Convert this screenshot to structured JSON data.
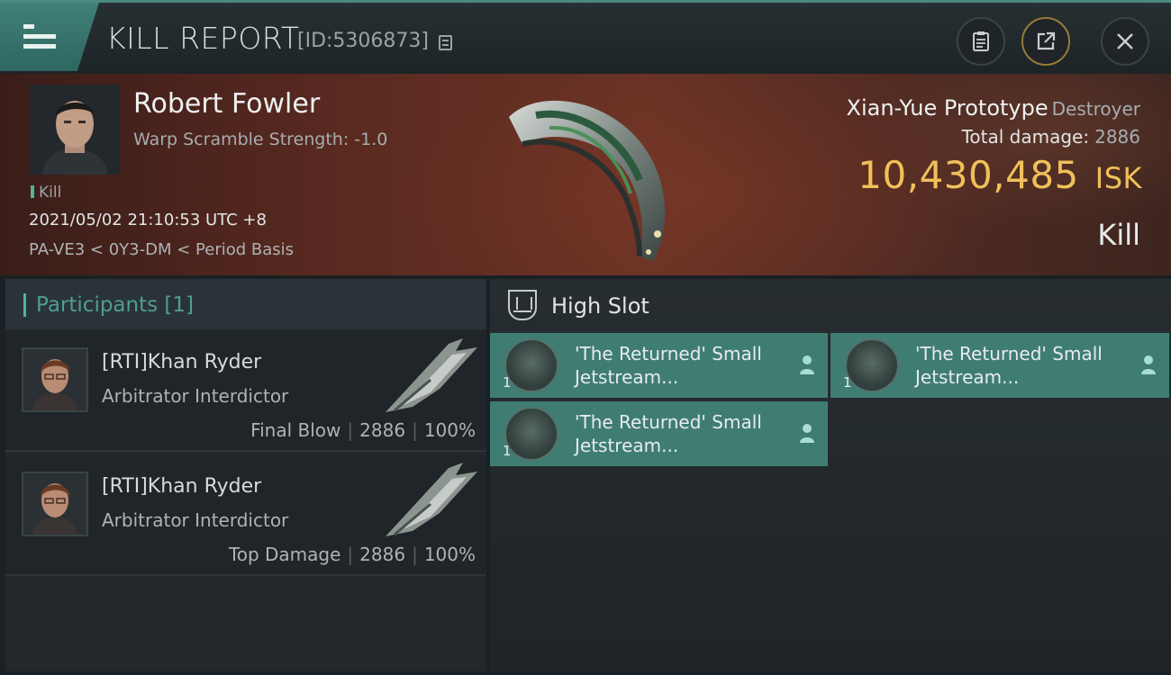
{
  "header": {
    "title": "KILL REPORT",
    "id_label": "[ID:5306873]",
    "icons": [
      "menu-icon",
      "copy-icon",
      "clipboard-icon",
      "share-icon",
      "close-icon"
    ]
  },
  "victim": {
    "name": "Robert Fowler",
    "scramble": "Warp Scramble Strength: -1.0",
    "tag": "Kill",
    "datetime": "2021/05/02 21:10:53 UTC +8",
    "location": "PA-VE3 < 0Y3-DM < Period Basis",
    "ship_name": "Xian-Yue Prototype",
    "ship_class": "Destroyer",
    "total_damage_label": "Total damage:",
    "total_damage": "2886",
    "isk_value": "10,430,485",
    "isk_unit": "ISK",
    "result": "Kill"
  },
  "participants": {
    "header_label": "Participants [1]",
    "rows": [
      {
        "name": "[RTI]Khan Ryder",
        "ship": "Arbitrator Interdictor",
        "role": "Final Blow",
        "damage": "2886",
        "percent": "100%"
      },
      {
        "name": "[RTI]Khan Ryder",
        "ship": "Arbitrator Interdictor",
        "role": "Top Damage",
        "damage": "2886",
        "percent": "100%"
      }
    ]
  },
  "slots": {
    "title": "High Slot",
    "modules": [
      {
        "line1": "'The Returned' Small",
        "line2": "Jetstream...",
        "qty": "1"
      },
      {
        "line1": "'The Returned' Small",
        "line2": "Jetstream...",
        "qty": "1"
      },
      {
        "line1": "'The Returned' Small",
        "line2": "Jetstream...",
        "qty": "1"
      }
    ]
  },
  "colors": {
    "accent_teal": "#3f7d73",
    "isk_gold": "#f0c05a",
    "participants_label": "#4f9d94"
  }
}
